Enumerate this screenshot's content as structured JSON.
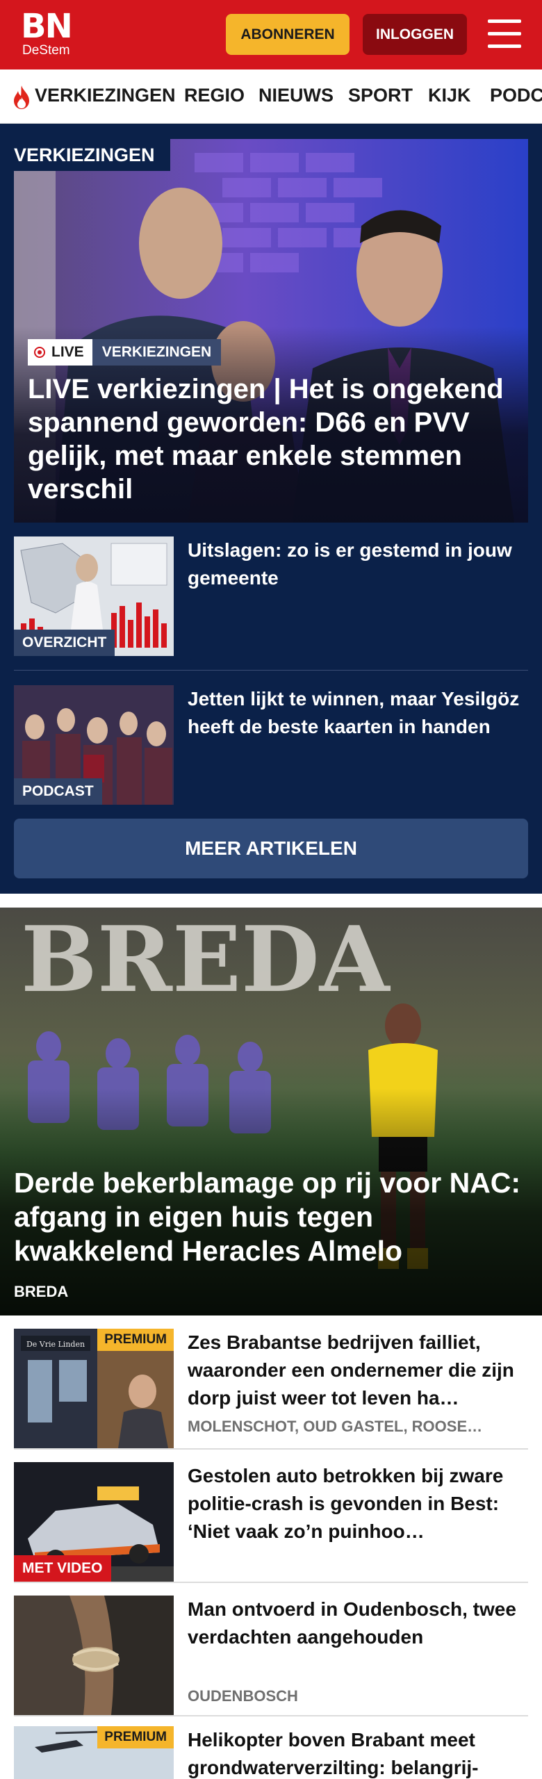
{
  "header": {
    "logo_main": "BN",
    "logo_sub": "DeStem",
    "subscribe_label": "ABONNEREN",
    "login_label": "INLOGGEN",
    "brand_color": "#d4161d"
  },
  "nav": {
    "items": [
      {
        "label": "VERKIEZINGEN",
        "icon": "flame-icon"
      },
      {
        "label": "REGIO"
      },
      {
        "label": "NIEUWS"
      },
      {
        "label": "SPORT"
      },
      {
        "label": "KIJK"
      },
      {
        "label": "PODCASTS"
      }
    ]
  },
  "election": {
    "section_label": "VERKIEZINGEN",
    "hero": {
      "live_badge": "LIVE",
      "category_badge": "VERKIEZINGEN",
      "title": "LIVE verkiezingen | Het is ongekend spannend geworden: D66 en PVV gelijk, met maar enkele stemmen verschil"
    },
    "items": [
      {
        "tag": "OVERZICHT",
        "title": "Uitslagen: zo is er gestemd in jouw gemeente"
      },
      {
        "tag": "PODCAST",
        "title": "Jetten lijkt te winnen, maar Yesilgöz heeft de beste kaarten in handen"
      }
    ],
    "more_label": "MEER ARTIKELEN"
  },
  "feature": {
    "title": "Derde bekerblamage op rij voor NAC: afgang in eigen huis tegen kwakkelend Heracles Almelo",
    "location": "BREDA",
    "banner_text": "BREDA"
  },
  "articles": [
    {
      "badge": "PREMIUM",
      "title": "Zes Brabantse bedrijven failliet, waaronder een ondernemer die zijn dorp juist weer tot leven ha…",
      "location": "MOLENSCHOT, OUD GASTEL, ROOSE…",
      "sign_text": "De Vrie Linden"
    },
    {
      "badge": "MET VIDEO",
      "title": "Gestolen auto betrokken bij zware politie-crash is gevonden in Best: ‘Niet vaak zo’n puinhoo…",
      "location": ""
    },
    {
      "badge": "",
      "title": "Man ontvoerd in Oudenbosch, twee verdachten aangehouden",
      "location": "OUDENBOSCH"
    },
    {
      "badge": "PREMIUM",
      "title": "Helikopter boven Brabant meet grondwaterverzilting: belangrij-",
      "location": ""
    }
  ]
}
